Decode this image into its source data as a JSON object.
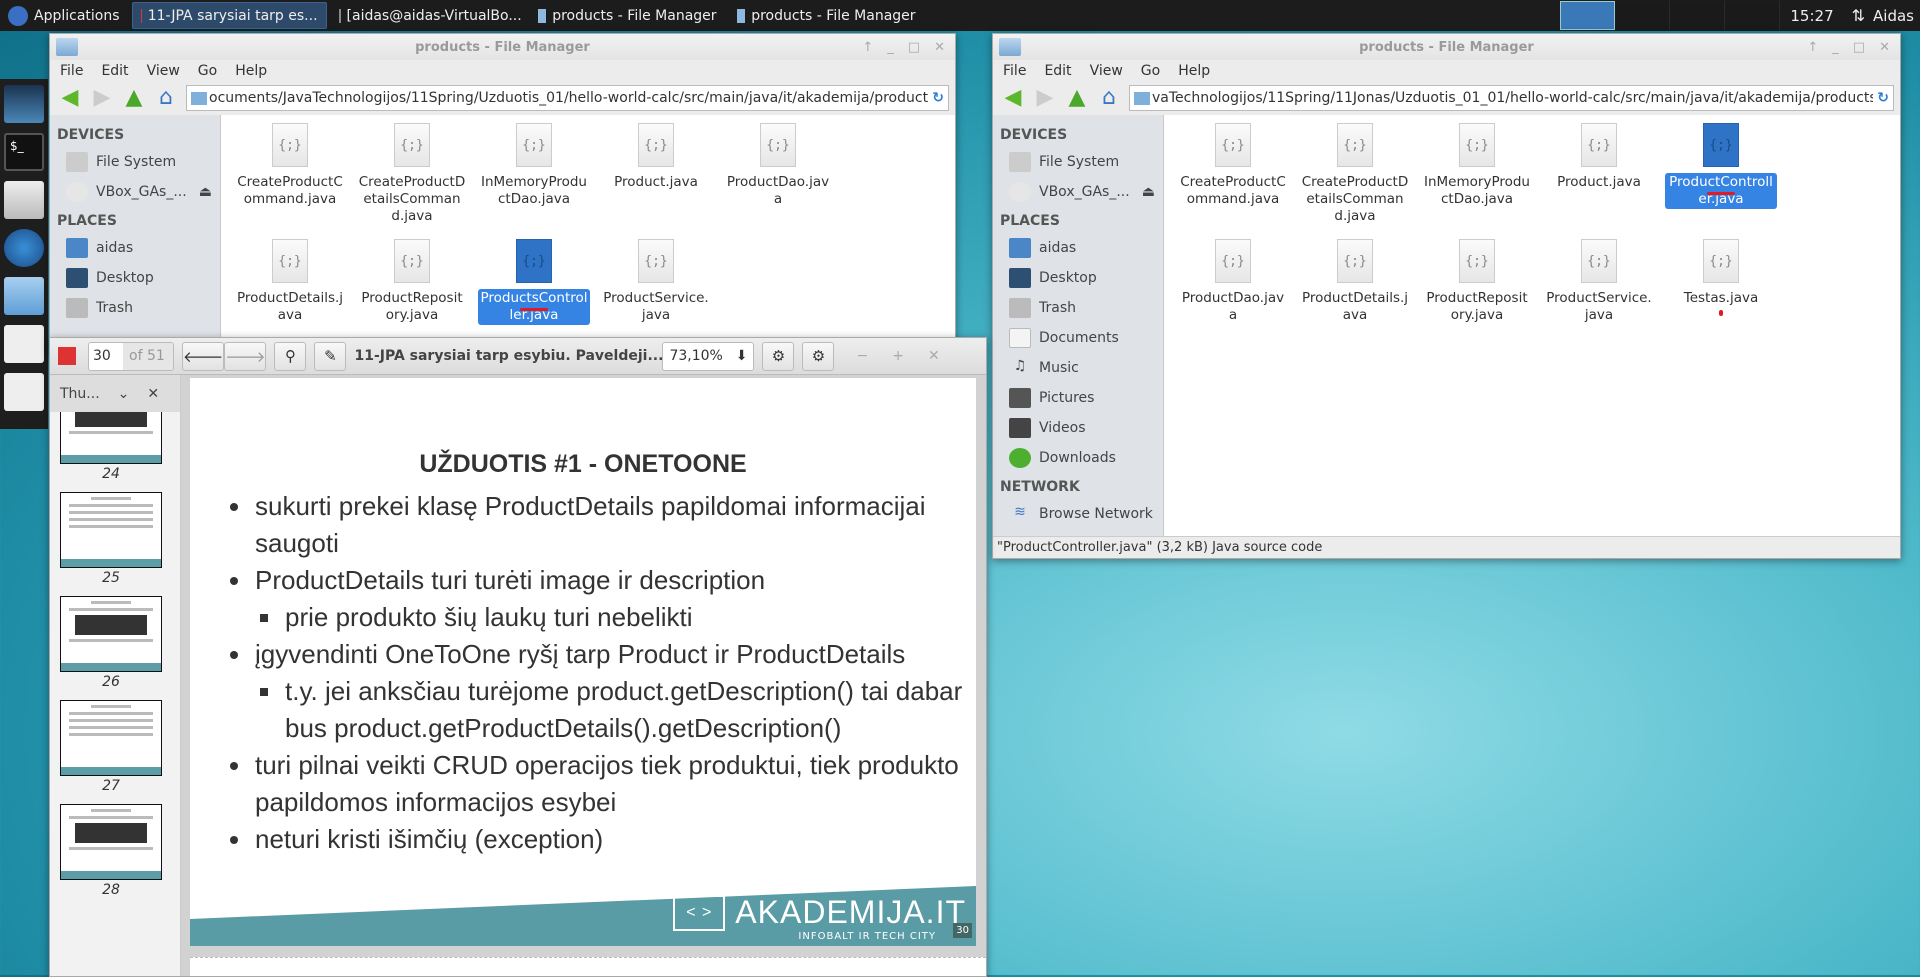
{
  "taskbar": {
    "applications": "Applications",
    "items": [
      {
        "label": "11-JPA sarysiai tarp es...",
        "icon": "pdf-icon",
        "active": true
      },
      {
        "label": "[aidas@aidas-VirtualBo...",
        "icon": "terminal-icon"
      },
      {
        "label": "products - File Manager",
        "icon": "folder-icon"
      },
      {
        "label": "products - File Manager",
        "icon": "folder-icon"
      }
    ],
    "clock": "15:27",
    "user": "Aidas"
  },
  "fm_left": {
    "title": "products - File Manager",
    "menu": [
      "File",
      "Edit",
      "View",
      "Go",
      "Help"
    ],
    "path": "ocuments/JavaTechnologijos/11Spring/Uzduotis_01/hello-world-calc/src/main/java/it/akademija/products/",
    "devices_label": "DEVICES",
    "devices": [
      "File System",
      "VBox_GAs_..."
    ],
    "places_label": "PLACES",
    "places": [
      "aidas",
      "Desktop",
      "Trash"
    ],
    "files": [
      "CreateProductCommand.java",
      "CreateProductDetailsCommand.java",
      "InMemoryProductDao.java",
      "Product.java",
      "ProductDao.java",
      "ProductDetails.java",
      "ProductRepository.java",
      "ProductsController.java",
      "ProductService.java"
    ],
    "selected": "ProductsController.java"
  },
  "fm_right": {
    "title": "products - File Manager",
    "menu": [
      "File",
      "Edit",
      "View",
      "Go",
      "Help"
    ],
    "path": "vaTechnologijos/11Spring/11Jonas/Uzduotis_01_01/hello-world-calc/src/main/java/it/akademija/products/",
    "devices_label": "DEVICES",
    "devices": [
      "File System",
      "VBox_GAs_..."
    ],
    "places_label": "PLACES",
    "places": [
      "aidas",
      "Desktop",
      "Trash",
      "Documents",
      "Music",
      "Pictures",
      "Videos",
      "Downloads"
    ],
    "network_label": "NETWORK",
    "network": [
      "Browse Network"
    ],
    "files": [
      "CreateProductCommand.java",
      "CreateProductDetailsCommand.java",
      "InMemoryProductDao.java",
      "Product.java",
      "ProductController.java",
      "ProductDao.java",
      "ProductDetails.java",
      "ProductRepository.java",
      "ProductService.java",
      "Testas.java"
    ],
    "selected": "ProductController.java",
    "status": "\"ProductController.java\" (3,2 kB) Java source code"
  },
  "pdf": {
    "page": "30",
    "of": "of 51",
    "title": "11-JPA sarysiai tarp esybiu. Paveldeji...",
    "zoom": "73,10%",
    "thumb_label": "Thu...",
    "thumbs": [
      "24",
      "25",
      "26",
      "27",
      "28"
    ],
    "slide": {
      "title": "UŽDUOTIS #1 - ONETOONE",
      "bullets": [
        {
          "text": "sukurti prekei klasę ProductDetails papildomai informacijai saugoti",
          "level": 1
        },
        {
          "text": "ProductDetails turi turėti image ir description",
          "level": 1
        },
        {
          "text": "prie produkto šių laukų turi nebelikti",
          "level": 2
        },
        {
          "text": "įgyvendinti OneToOne ryšį tarp Product ir ProductDetails",
          "level": 1
        },
        {
          "text": "t.y. jei anksčiau turėjome product.getDescription() tai dabar bus product.getProductDetails().getDescription()",
          "level": 2
        },
        {
          "text": "turi pilnai veikti CRUD operacijos tiek produktui, tiek produkto papildomos informacijos esybei",
          "level": 1
        },
        {
          "text": "neturi kristi išimčių (exception)",
          "level": 1
        }
      ],
      "logo": "AKADEMIJA.IT",
      "logo_sub": "INFOBALT IR TECH CITY",
      "page_number": "30"
    }
  },
  "colors": {
    "selection": "#3584e4",
    "slide_band": "#5a9ca5",
    "taskbar": "#1c1c1c"
  }
}
